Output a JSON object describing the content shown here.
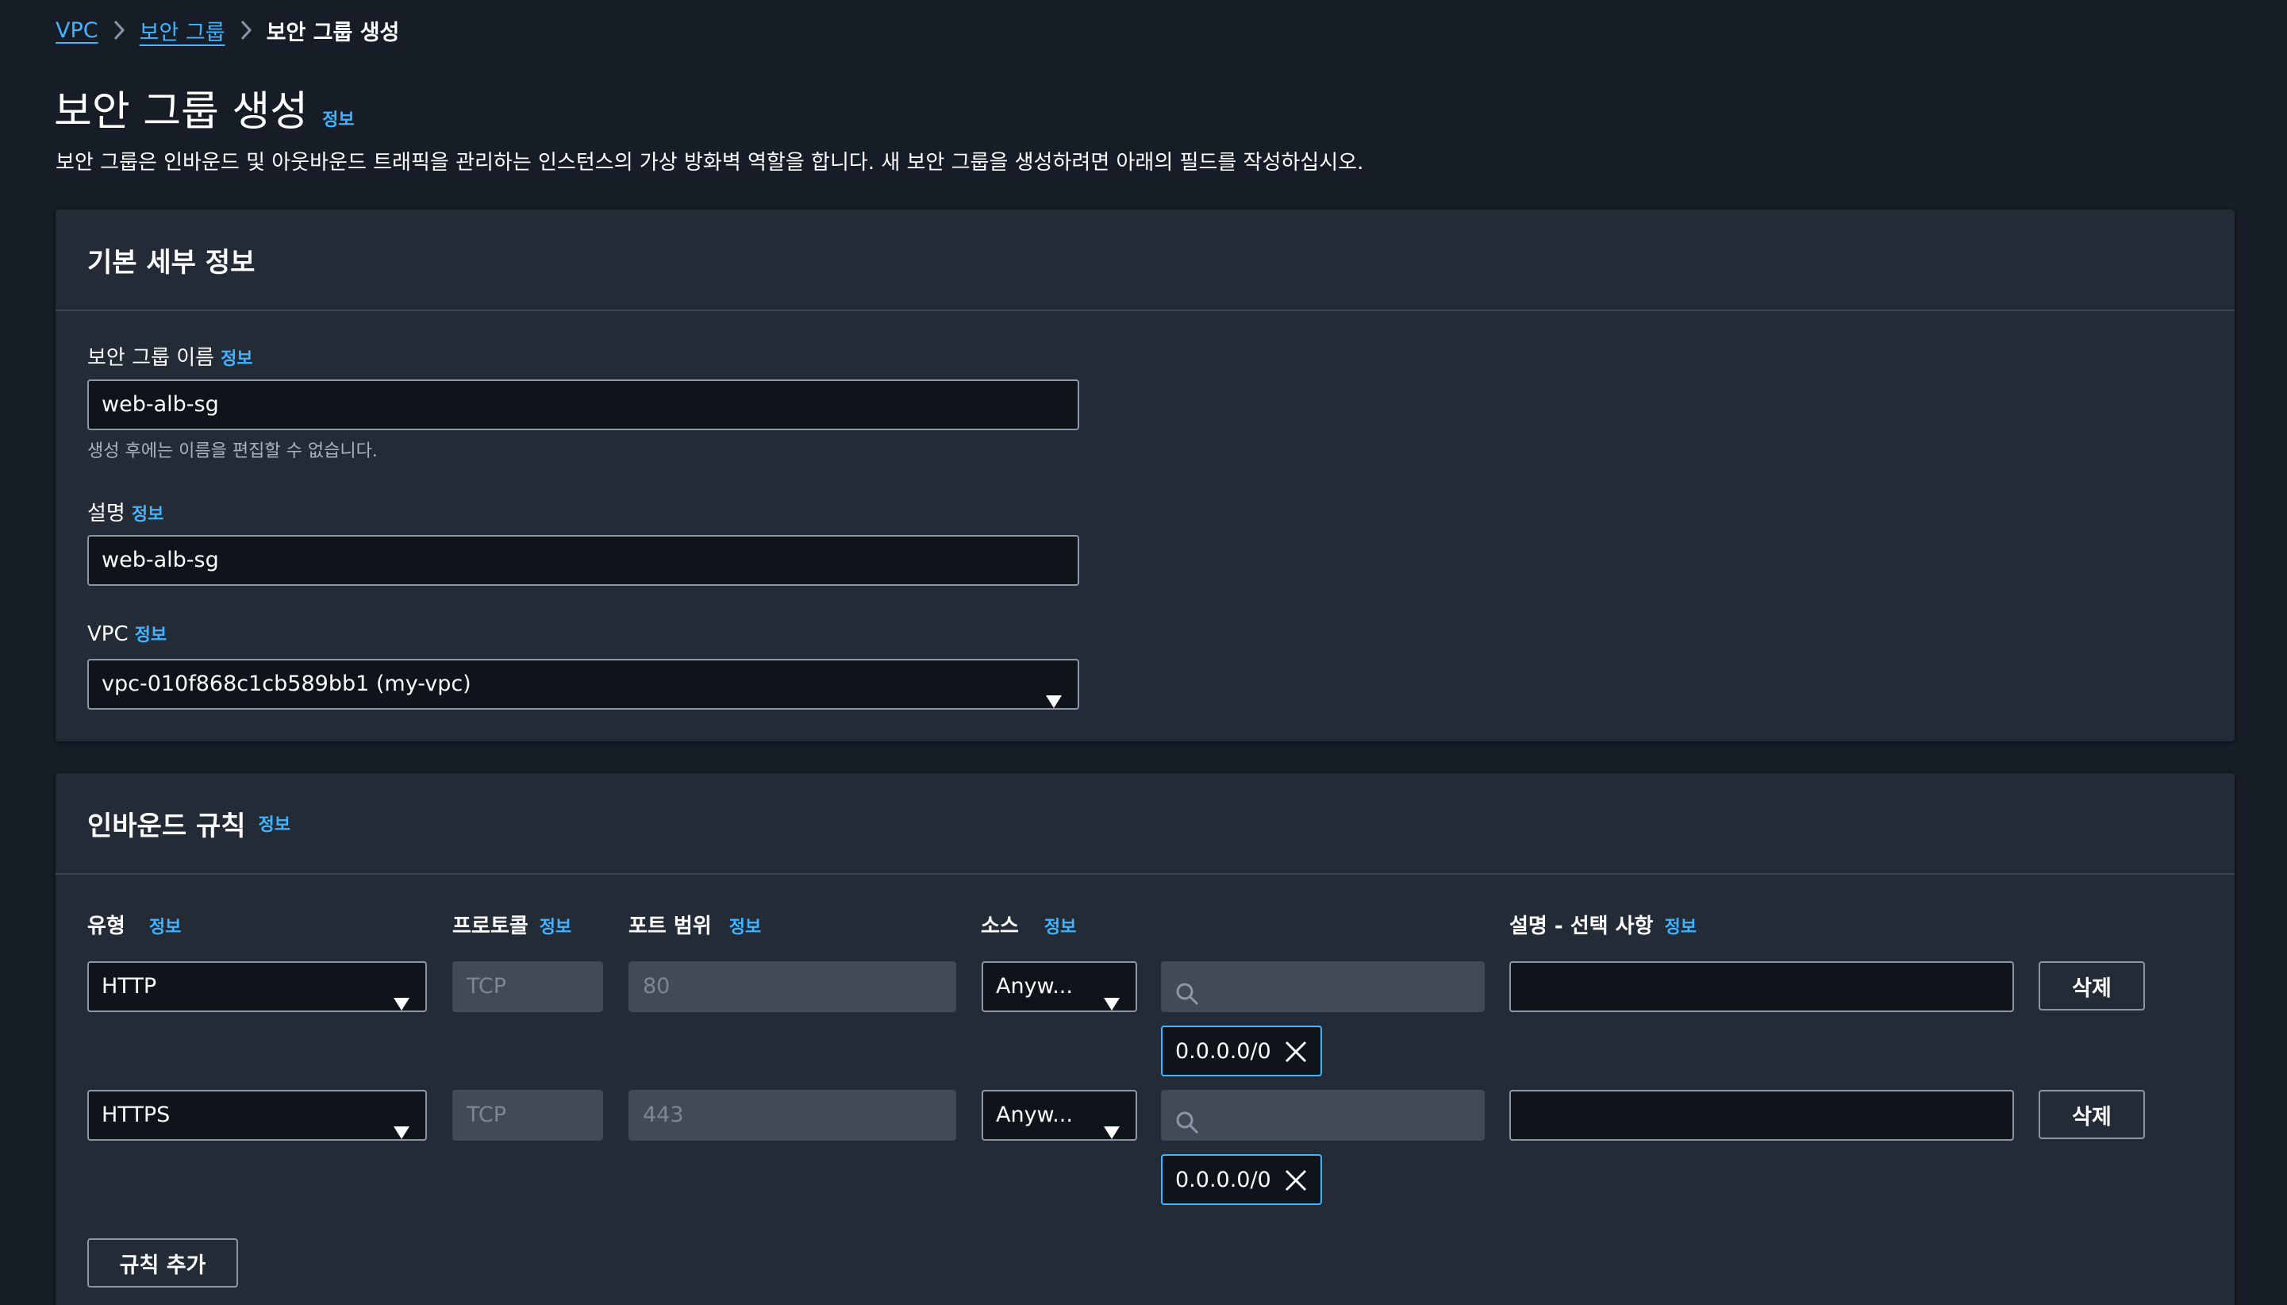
{
  "breadcrumb": {
    "root": "VPC",
    "parent": "보안 그룹",
    "current": "보안 그룹 생성"
  },
  "page": {
    "title": "보안 그룹 생성",
    "info": "정보",
    "description": "보안 그룹은 인바운드 및 아웃바운드 트래픽을 관리하는 인스턴스의 가상 방화벽 역할을 합니다. 새 보안 그룹을 생성하려면 아래의 필드를 작성하십시오."
  },
  "basic": {
    "title": "기본 세부 정보",
    "name_label": "보안 그룹 이름",
    "name_value": "web-alb-sg",
    "name_hint": "생성 후에는 이름을 편집할 수 없습니다.",
    "desc_label": "설명",
    "desc_value": "web-alb-sg",
    "vpc_label": "VPC",
    "vpc_value": "vpc-010f868c1cb589bb1 (my-vpc)",
    "info": "정보"
  },
  "inbound": {
    "title": "인바운드 규칙",
    "info": "정보",
    "columns": {
      "type": "유형",
      "protocol": "프로토콜",
      "port_range": "포트 범위",
      "source": "소스",
      "description": "설명 - 선택 사항"
    },
    "rules": [
      {
        "type": "HTTP",
        "protocol": "TCP",
        "port": "80",
        "source": "Anyw...",
        "cidr": "0.0.0.0/0",
        "delete": "삭제"
      },
      {
        "type": "HTTPS",
        "protocol": "TCP",
        "port": "443",
        "source": "Anyw...",
        "cidr": "0.0.0.0/0",
        "delete": "삭제"
      }
    ],
    "add_rule": "규칙 추가"
  },
  "colors": {
    "background": "#161d26",
    "panel": "#232b37",
    "link": "#42b4ff",
    "border": "#8c96a6"
  },
  "icons": [
    "chevron-right-icon",
    "caret-down-icon",
    "search-icon",
    "close-icon"
  ]
}
